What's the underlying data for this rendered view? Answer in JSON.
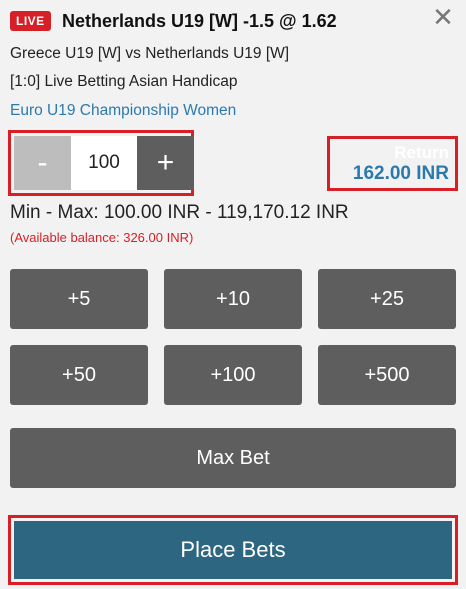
{
  "header": {
    "live_badge": "LIVE",
    "title": "Netherlands U19 [W] -1.5 @ 1.62",
    "close_symbol": "✕"
  },
  "event": {
    "match": "Greece U19 [W] vs Netherlands U19 [W]",
    "market": "[1:0] Live Betting Asian Handicap",
    "league": "Euro U19 Championship Women"
  },
  "stake": {
    "minus_label": "-",
    "value": "100",
    "plus_label": "+"
  },
  "return": {
    "label": "Return",
    "value": "162.00 INR"
  },
  "limits": {
    "min_max": "Min - Max: 100.00 INR - 119,170.12 INR",
    "balance": "(Available balance: 326.00 INR)"
  },
  "quick_stakes": [
    "+5",
    "+10",
    "+25",
    "+50",
    "+100",
    "+500"
  ],
  "actions": {
    "max_bet": "Max Bet",
    "place_bets": "Place Bets"
  },
  "colors": {
    "accent_red": "#d61f26",
    "button_gray": "#5e5e5e",
    "place_blue": "#2d6680",
    "link_blue": "#2a7ab0"
  }
}
